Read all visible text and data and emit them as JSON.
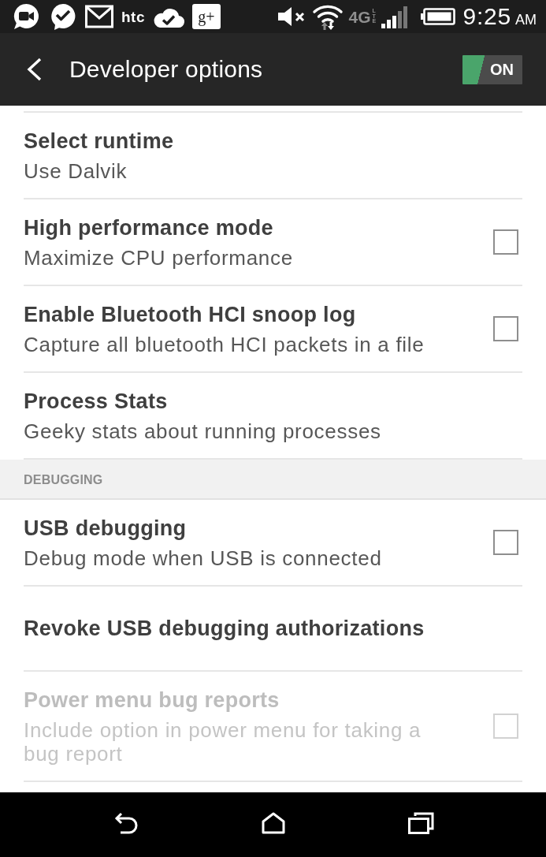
{
  "status_bar": {
    "brand_label": "htc",
    "app_tile_label": "g+",
    "network_type": "4G",
    "network_subtype": "LTE",
    "time": "9:25",
    "period": "AM"
  },
  "header": {
    "title": "Developer options",
    "toggle": {
      "label": "ON",
      "on": true
    }
  },
  "groups": [
    {
      "items": [
        {
          "kind": "plain",
          "title": "Select runtime",
          "summary": "Use Dalvik",
          "disabled": false
        },
        {
          "kind": "checkbox",
          "title": "High performance mode",
          "summary": "Maximize CPU performance",
          "checked": false,
          "disabled": false
        },
        {
          "kind": "checkbox",
          "title": "Enable Bluetooth HCI snoop log",
          "summary": "Capture all bluetooth HCI packets in a file",
          "checked": false,
          "disabled": false
        },
        {
          "kind": "plain",
          "title": "Process Stats",
          "summary": "Geeky stats about running processes",
          "disabled": false
        }
      ]
    },
    {
      "header": "DEBUGGING",
      "items": [
        {
          "kind": "checkbox",
          "title": "USB debugging",
          "summary": "Debug mode when USB is connected",
          "checked": false,
          "disabled": false
        },
        {
          "kind": "plain",
          "title": "Revoke USB debugging authorizations",
          "disabled": false
        },
        {
          "kind": "checkbox",
          "title": "Power menu bug reports",
          "summary": "Include option in power menu for taking a bug report",
          "checked": false,
          "disabled": true
        }
      ]
    }
  ]
}
